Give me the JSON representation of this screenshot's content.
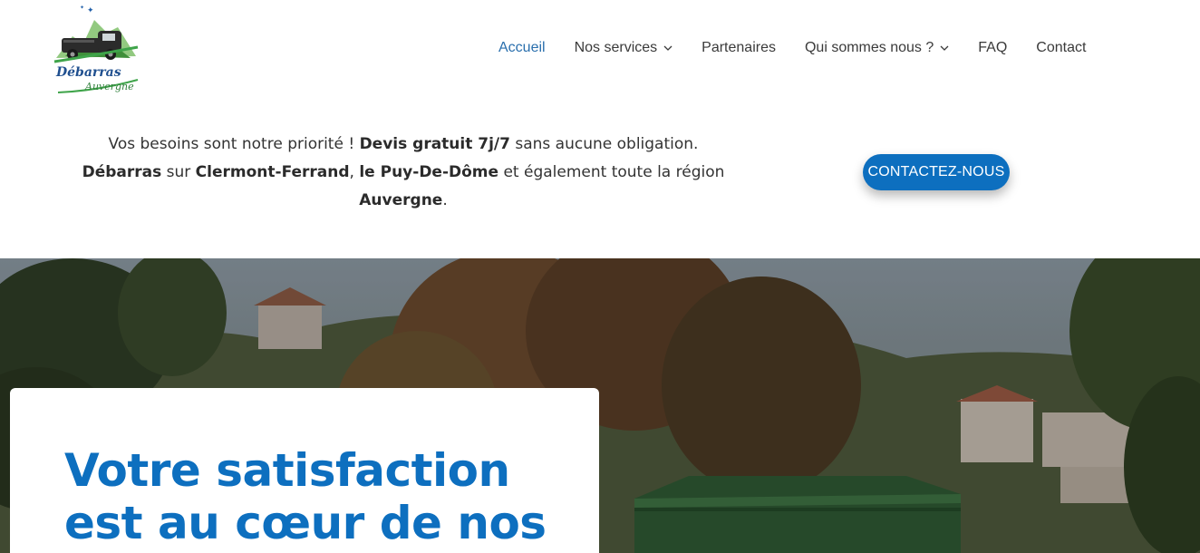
{
  "brand": {
    "logo_text_line1": "Débarras",
    "logo_text_line2": "Auvergne"
  },
  "nav": {
    "items": [
      {
        "label": "Accueil",
        "active": true,
        "dropdown": false
      },
      {
        "label": "Nos services",
        "active": false,
        "dropdown": true
      },
      {
        "label": "Partenaires",
        "active": false,
        "dropdown": false
      },
      {
        "label": "Qui sommes nous ?",
        "active": false,
        "dropdown": true
      },
      {
        "label": "FAQ",
        "active": false,
        "dropdown": false
      },
      {
        "label": "Contact",
        "active": false,
        "dropdown": false
      }
    ]
  },
  "intro": {
    "p1": "Vos besoins sont notre priorité ! ",
    "b1": "Devis gratuit 7j/7",
    "p2": " sans aucune obligation.",
    "b2": "Débarras",
    "p3": " sur ",
    "b3": "Clermont-Ferrand",
    "p4": ", ",
    "b4": "le Puy-De-Dôme",
    "p5": " et également toute la région ",
    "b5": "Auvergne",
    "p6": "."
  },
  "cta": {
    "label": "CONTACTEZ-NOUS"
  },
  "hero": {
    "title": "Votre satisfaction est au cœur de nos"
  },
  "colors": {
    "accent": "#0d6fbf",
    "nav_active": "#2a6fad",
    "text": "#333333"
  }
}
